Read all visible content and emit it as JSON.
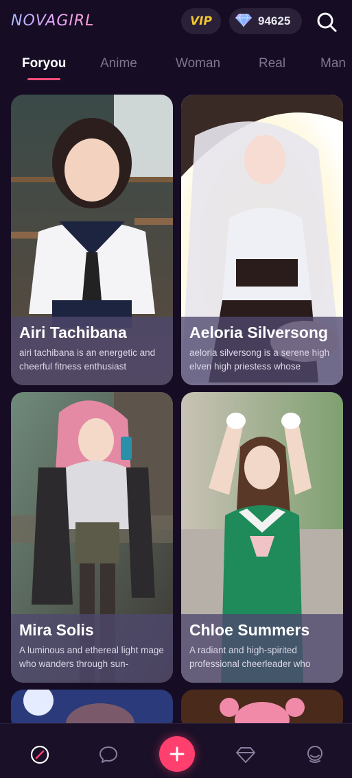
{
  "app": {
    "logo": "NOVAGIRL"
  },
  "header": {
    "vip_label": "VIP",
    "gem_count": "94625",
    "gem_icon": "diamond-icon",
    "search_icon": "search-icon"
  },
  "tabs": [
    {
      "label": "Foryou",
      "active": true
    },
    {
      "label": "Anime",
      "active": false
    },
    {
      "label": "Woman",
      "active": false
    },
    {
      "label": "Real",
      "active": false
    },
    {
      "label": "Man",
      "active": false
    }
  ],
  "cards": [
    {
      "name": "Airi Tachibana",
      "desc": "airi tachibana is an energetic and cheerful fitness enthusiast"
    },
    {
      "name": "Aeloria Silversong",
      "desc": "aeloria silversong is a serene high elven high priestess whose"
    },
    {
      "name": "Mira Solis",
      "desc": "A luminous and ethereal light mage who wanders through sun-"
    },
    {
      "name": "Chloe Summers",
      "desc": "A radiant and high-spirited professional cheerleader who"
    }
  ],
  "bottom_nav": [
    {
      "icon": "compass-icon",
      "active": true
    },
    {
      "icon": "chat-icon",
      "active": false
    },
    {
      "icon": "plus-icon",
      "active": false
    },
    {
      "icon": "diamond-icon",
      "active": false
    },
    {
      "icon": "profile-icon",
      "active": false
    }
  ],
  "colors": {
    "background": "#160d24",
    "accent": "#ff3f6e",
    "vip_gold": "#f2c531",
    "card_overlay": "#4e486e"
  }
}
